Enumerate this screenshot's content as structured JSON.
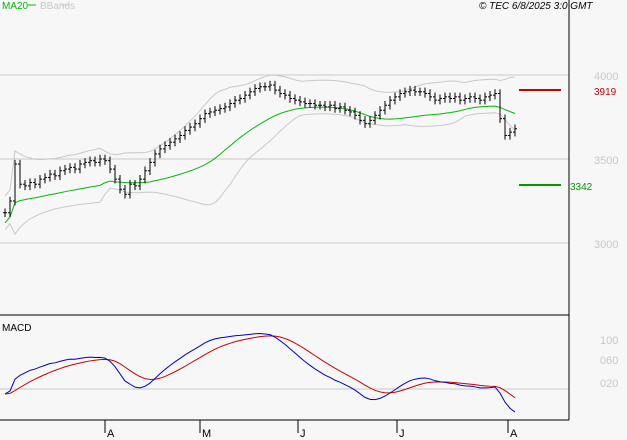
{
  "header": {
    "legend_ma": "MA20",
    "legend_bb": "BBands",
    "copyright": "© TEC 6/8/2025 3:0 GMT"
  },
  "colors": {
    "ma": "#00bb00",
    "bb": "#c8c8c8",
    "macd": "#0000cc",
    "signal": "#cc0000",
    "high_marker": "#cc0000",
    "low_marker": "#009900"
  },
  "chart_data": {
    "type": "ohlc",
    "price_axis": {
      "ticks": [
        "4000",
        "3500",
        "3000"
      ],
      "values": [
        40,
        35,
        30
      ]
    },
    "markers": {
      "high": {
        "label": "3919",
        "value": 39.19
      },
      "low": {
        "label": "3342",
        "value": 33.42
      }
    },
    "x_ticks": [
      "A",
      "M",
      "J",
      "J",
      "A"
    ],
    "macd": {
      "title": "MACD",
      "ticks": [
        "100",
        "060",
        "020"
      ],
      "values": [
        1.0,
        0.6,
        0.2
      ]
    },
    "closes": [
      31.8,
      32.5,
      34.7,
      33.5,
      33.4,
      33.6,
      33.5,
      33.8,
      33.9,
      34.1,
      34.0,
      34.3,
      34.4,
      34.5,
      34.4,
      34.7,
      34.8,
      34.9,
      34.8,
      35.0,
      34.9,
      34.4,
      33.8,
      33.2,
      32.9,
      33.5,
      33.4,
      33.8,
      34.3,
      34.8,
      35.3,
      35.6,
      35.8,
      36.0,
      36.2,
      36.4,
      36.7,
      36.9,
      37.1,
      37.4,
      37.7,
      37.8,
      37.9,
      38.0,
      38.1,
      38.3,
      38.5,
      38.6,
      38.8,
      39.0,
      39.2,
      39.3,
      39.3,
      39.4,
      39.1,
      38.9,
      38.8,
      38.6,
      38.5,
      38.4,
      38.3,
      38.3,
      38.2,
      38.2,
      38.1,
      38.2,
      38.0,
      38.1,
      37.9,
      37.8,
      37.6,
      37.3,
      37.1,
      37.3,
      37.6,
      37.9,
      38.2,
      38.5,
      38.7,
      38.9,
      39.0,
      39.1,
      39.0,
      39.0,
      38.9,
      38.7,
      38.5,
      38.6,
      38.7,
      38.6,
      38.7,
      38.5,
      38.6,
      38.7,
      38.6,
      38.5,
      38.7,
      38.8,
      38.9,
      37.4,
      36.4,
      36.6,
      36.8
    ]
  }
}
